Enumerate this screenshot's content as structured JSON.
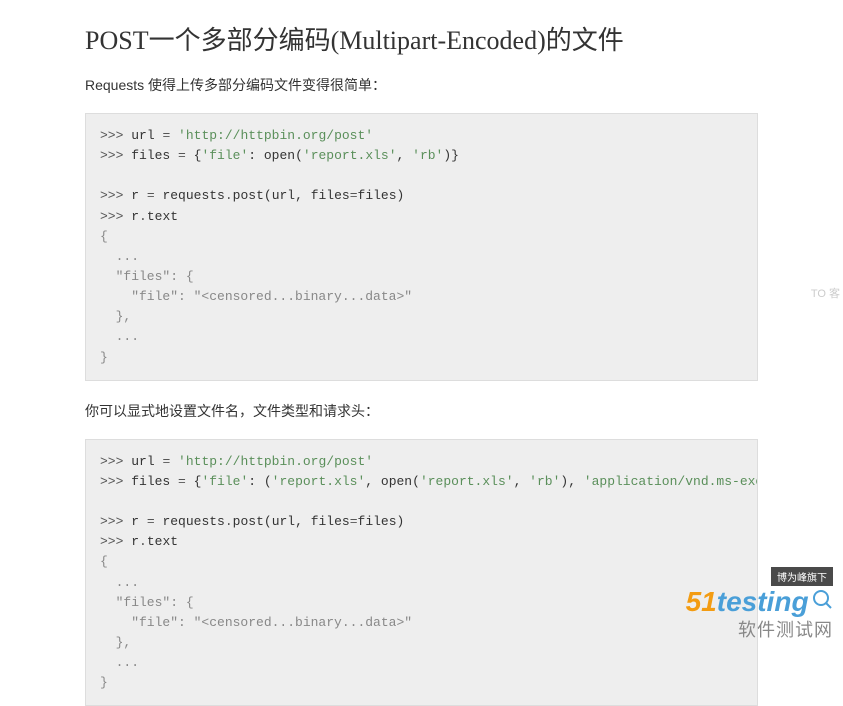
{
  "heading": "POST一个多部分编码(Multipart-Encoded)的文件",
  "para1": "Requests 使得上传多部分编码文件变得很简单：",
  "para2": "你可以显式地设置文件名，文件类型和请求头：",
  "code1": {
    "l1p": ">>> ",
    "l1a": "url ",
    "l1b": "=",
    "l1c": " 'http://httpbin.org/post'",
    "l2p": ">>> ",
    "l2a": "files ",
    "l2b": "=",
    "l2c": " {",
    "l2d": "'file'",
    "l2e": ": ",
    "l2f": "open",
    "l2g": "(",
    "l2h": "'report.xls'",
    "l2i": ", ",
    "l2j": "'rb'",
    "l2k": ")}",
    "l3p": ">>> ",
    "l3a": "r ",
    "l3b": "=",
    "l3c": " requests",
    "l3d": ".",
    "l3e": "post",
    "l3f": "(",
    "l3g": "url, files",
    "l3h": "=",
    "l3i": "files)",
    "l4p": ">>> ",
    "l4a": "r",
    "l4b": ".",
    "l4c": "text",
    "out": "{\n  ...\n  \"files\": {\n    \"file\": \"<censored...binary...data>\"\n  },\n  ...\n}"
  },
  "code2": {
    "l1p": ">>> ",
    "l1a": "url ",
    "l1b": "=",
    "l1c": " 'http://httpbin.org/post'",
    "l2p": ">>> ",
    "l2a": "files ",
    "l2b": "=",
    "l2c": " {",
    "l2d": "'file'",
    "l2e": ": (",
    "l2f": "'report.xls'",
    "l2g": ", ",
    "l2h": "open",
    "l2i": "(",
    "l2j": "'report.xls'",
    "l2k": ", ",
    "l2l": "'rb'",
    "l2m": "), ",
    "l2n": "'application/vnd.ms-excel'",
    "l3p": ">>> ",
    "l3a": "r ",
    "l3b": "=",
    "l3c": " requests",
    "l3d": ".",
    "l3e": "post",
    "l3f": "(",
    "l3g": "url, files",
    "l3h": "=",
    "l3i": "files)",
    "l4p": ">>> ",
    "l4a": "r",
    "l4b": ".",
    "l4c": "text",
    "out": "{\n  ...\n  \"files\": {\n    \"file\": \"<censored...binary...data>\"\n  },\n  ...\n}"
  },
  "watermark": {
    "badge": "博为峰旗下",
    "logo_num": "51",
    "logo_text": "testing",
    "sub": "软件测试网",
    "side": "TO 客"
  }
}
